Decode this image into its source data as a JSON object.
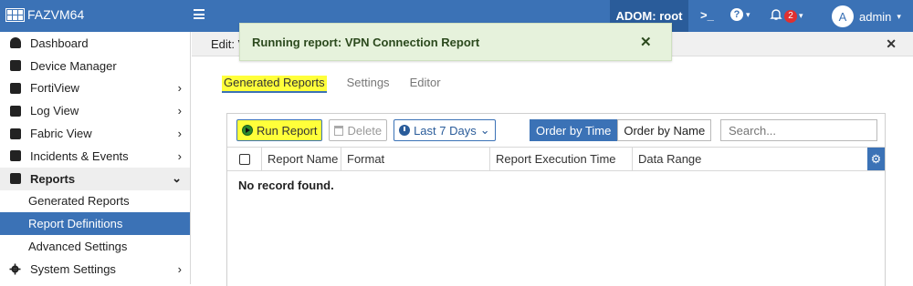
{
  "topbar": {
    "product": "FAZVM64",
    "adom": "ADOM: root",
    "cli": ">_",
    "help_icon": "?",
    "notification_count": "2",
    "avatar_letter": "A",
    "user": "admin"
  },
  "sidebar": {
    "items": [
      {
        "label": "Dashboard",
        "icon": "dashboard-icon"
      },
      {
        "label": "Device Manager",
        "icon": "device-manager-icon"
      },
      {
        "label": "FortiView",
        "icon": "fortiview-icon"
      },
      {
        "label": "Log View",
        "icon": "log-view-icon"
      },
      {
        "label": "Fabric View",
        "icon": "fabric-view-icon"
      },
      {
        "label": "Incidents & Events",
        "icon": "incidents-icon"
      },
      {
        "label": "Reports",
        "icon": "reports-icon"
      },
      {
        "label": "Generated Reports"
      },
      {
        "label": "Report Definitions"
      },
      {
        "label": "Advanced Settings"
      },
      {
        "label": "System Settings",
        "icon": "gear-icon"
      }
    ]
  },
  "content": {
    "edit_title": "Edit: V",
    "tabs": [
      "Generated Reports",
      "Settings",
      "Editor"
    ],
    "toolbar": {
      "run": "Run Report",
      "delete": "Delete",
      "range": "Last 7 Days",
      "order_time": "Order by Time",
      "order_name": "Order by Name",
      "search_placeholder": "Search..."
    },
    "columns": [
      "Report Name",
      "Format",
      "Report Execution Time",
      "Data Range"
    ],
    "empty": "No record found."
  },
  "toast": {
    "message": "Running report: VPN Connection Report",
    "close": "✕"
  },
  "colors": {
    "brand": "#3b72b6",
    "highlight": "#ffff3a",
    "toast_bg": "#e6f2dc"
  }
}
